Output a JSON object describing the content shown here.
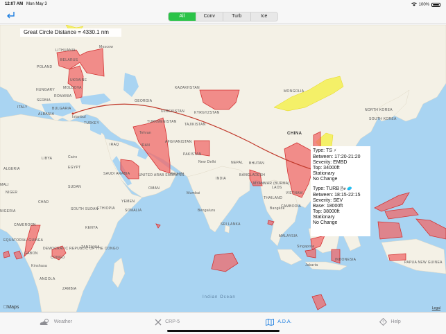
{
  "status": {
    "time": "12:07 AM",
    "date": "Mon May 3",
    "battery": "100%"
  },
  "nav": {
    "segments": [
      {
        "label": "All",
        "active": true
      },
      {
        "label": "Conv",
        "active": false
      },
      {
        "label": "Turb",
        "active": false
      },
      {
        "label": "Ice",
        "active": false
      }
    ]
  },
  "map": {
    "distance": "Great Circle Distance = 4330.1 nm",
    "labels": {
      "moscow": "Moscow",
      "lithuania": "LITHUANIA",
      "belarus": "BELARUS",
      "poland": "POLAND",
      "ukraine": "UKRAINE",
      "moldova": "MOLDOVA",
      "hungary": "HUNGARY",
      "romania": "ROMANIA",
      "serbia": "SERBIA",
      "italy": "ITALY",
      "bulgaria": "BULGARIA",
      "albania": "ALBANIA",
      "istanbul": "Istanbul",
      "turkey": "TURKEY",
      "georgia": "GEORGIA",
      "kazakhstan": "KAZAKHSTAN",
      "mongolia": "MONGOLIA",
      "uzbekistan": "UZBEKISTAN",
      "kyrgyzstan": "KYRGYZSTAN",
      "turkmenistan": "TURKMENISTAN",
      "tajikistan": "TAJIKISTAN",
      "tehran": "Tehran",
      "afghanistan": "AFGHANISTAN",
      "iran": "IRAN",
      "iraq": "IRAQ",
      "pakistan": "PAKISTAN",
      "china": "CHINA",
      "new_delhi": "New Delhi",
      "nepal": "NEPAL",
      "bhutan": "BHUTAN",
      "cairo": "Cairo",
      "egypt": "EGYPT",
      "libya": "LIBYA",
      "saudi": "SAUDI ARABIA",
      "uae": "UNITED ARAB EMIRATES",
      "oman": "OMAN",
      "karachi": "Karachi",
      "india": "INDIA",
      "bangladesh": "BANGLADESH",
      "myanmar": "MYANMAR (BURMA)",
      "mumbai": "Mumbai",
      "bengaluru": "Bengaluru",
      "sudan": "SUDAN",
      "chad": "CHAD",
      "yemen": "YEMEN",
      "ethiopia": "ETHIOPIA",
      "south_sudan": "SOUTH SUDAN",
      "somalia": "SOMALIA",
      "kenya": "KENYA",
      "tanzania": "TANZANIA",
      "drc": "DEMOCRATIC REPUBLIC OF THE CONGO",
      "congo": "CONGO",
      "gabon": "GABON",
      "cameroon": "CAMEROON",
      "nigeria": "NIGERIA",
      "niger": "NIGER",
      "mali": "MALI",
      "algeria": "ALGERIA",
      "angola": "ANGOLA",
      "zambia": "ZAMBIA",
      "kinshasa": "Kinshasa",
      "eq_guinea": "EQUATORIAL GUINEA",
      "sri_lanka": "SRI LANKA",
      "bangkok": "Bangkok",
      "thailand": "THAILAND",
      "laos": "LAOS",
      "vietnam": "VIETNAM",
      "cambodia": "CAMBODIA",
      "malaysia": "MALAYSIA",
      "singapore": "Singapore",
      "indonesia": "INDONESIA",
      "jakarta": "Jakarta",
      "south_korea": "SOUTH KOREA",
      "north_korea": "NORTH KOREA",
      "papua": "PAPUA NEW GUINEA",
      "indian_ocean": "Indian Ocean",
      "maps": "Maps",
      "legal": "Legal"
    }
  },
  "callout": {
    "sigmet1": {
      "type": "Type: TS",
      "type_emoji": "⚡",
      "between": "Between: 17:20-21:20",
      "severity": "Severity: EMBD",
      "top": "Top: 34000ft",
      "movement": "Stationary",
      "change": "No Change"
    },
    "sigmet2": {
      "type": "Type: TURB",
      "type_emoji": "🌬 🥏",
      "between": "Between: 18:15-22:15",
      "severity": "Severity: SEV",
      "base": "Base: 18000ft",
      "top": "Top: 38000ft",
      "movement": "Stationary",
      "change": "No Change"
    }
  },
  "tabs": [
    {
      "label": "Weather",
      "icon": "cloud-sun-icon",
      "active": false
    },
    {
      "label": "CRP-5",
      "icon": "wrench-icon",
      "active": false
    },
    {
      "label": "A.D.A.",
      "icon": "map-icon",
      "active": true
    },
    {
      "label": "Help",
      "icon": "help-icon",
      "active": false
    }
  ],
  "colors": {
    "accent": "#1e7fe0",
    "segment_active": "#2bc348",
    "sigmet_fill": "#f06a6a",
    "ice_fill": "#f4ef5a",
    "route": "#c0392b"
  }
}
